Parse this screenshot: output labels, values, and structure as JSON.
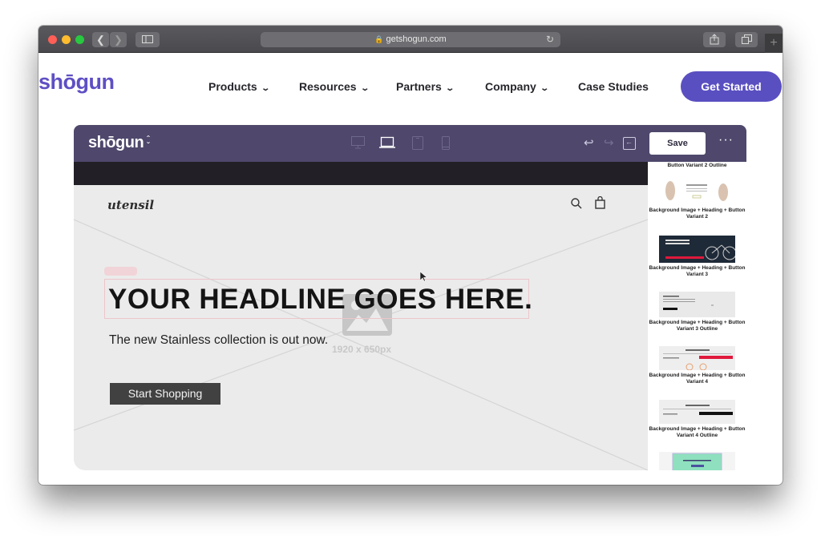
{
  "browser": {
    "url": "getshogun.com",
    "icons": {
      "back": "chevron-left-icon",
      "forward": "chevron-right-icon",
      "sidebar": "sidebar-icon",
      "lock": "lock-icon",
      "reload": "reload-icon",
      "share": "share-icon",
      "tabs": "tabs-icon",
      "new_tab": "plus-icon"
    }
  },
  "site_nav": {
    "logo": "shōgun",
    "items": [
      {
        "label": "Products",
        "has_dropdown": true
      },
      {
        "label": "Resources",
        "has_dropdown": true
      },
      {
        "label": "Partners",
        "has_dropdown": true
      },
      {
        "label": "Company",
        "has_dropdown": true
      },
      {
        "label": "Case Studies",
        "has_dropdown": false
      }
    ],
    "cta": "Get Started",
    "brand_color": "#5a4fc1"
  },
  "editor": {
    "logo": "shōgun",
    "devices": [
      "desktop",
      "laptop",
      "tablet",
      "mobile"
    ],
    "active_device": "laptop",
    "save_label": "Save",
    "more_label": "···",
    "bar_color": "#4f486c"
  },
  "canvas": {
    "store_name": "utensil",
    "headline": "YOUR HEADLINE GOES HERE.",
    "subtext": "The new Stainless collection is out now.",
    "button": "Start Shopping",
    "image_placeholder_size": "1920 x 650px"
  },
  "panel": {
    "items": [
      {
        "label": "Button Variant 2 Outline",
        "thumb": "partial"
      },
      {
        "label": "Background Image + Heading + Button Variant 2",
        "thumb": "utensils"
      },
      {
        "label": "Background Image + Heading + Button Variant 3",
        "thumb": "bike-dark"
      },
      {
        "label": "Background Image + Heading + Button Variant 3 Outline",
        "thumb": "light"
      },
      {
        "label": "Background Image + Heading + Button Variant  4",
        "thumb": "bike-store"
      },
      {
        "label": "Background Image + Heading + Button Variant  4 Outline",
        "thumb": "bike-store-outline"
      },
      {
        "label": "",
        "thumb": "green-sale"
      }
    ]
  }
}
